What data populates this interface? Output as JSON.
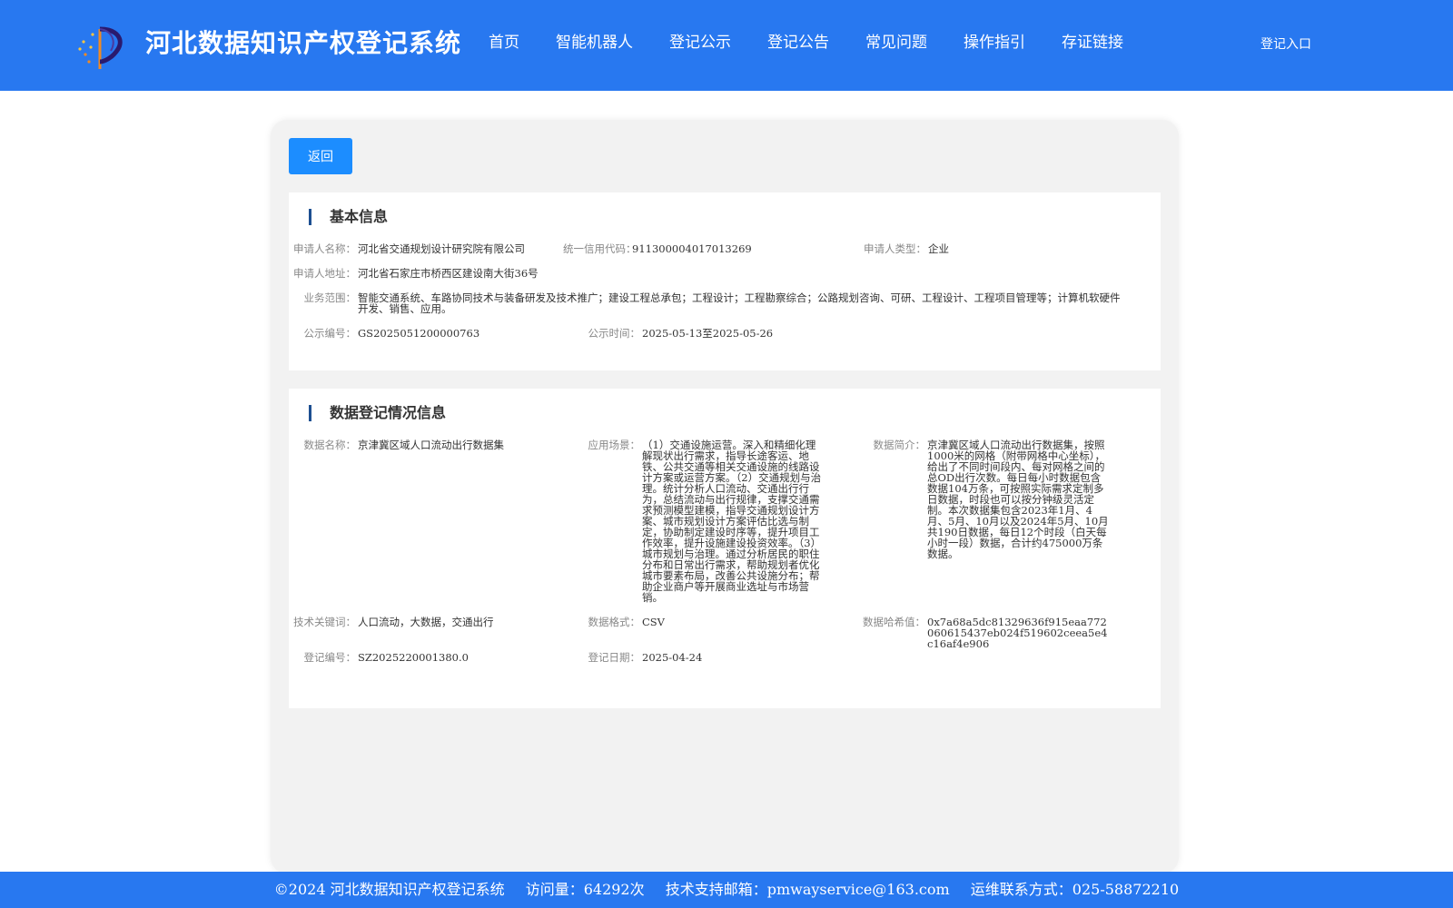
{
  "header": {
    "title": "河北数据知识产权登记系统",
    "nav": [
      "首页",
      "智能机器人",
      "登记公示",
      "登记公告",
      "常见问题",
      "操作指引",
      "存证链接"
    ],
    "login": "登记入口"
  },
  "back_label": "返回",
  "basic": {
    "title": "基本信息",
    "applicant_name_label": "申请人名称：",
    "applicant_name": "河北省交通规划设计研究院有限公司",
    "credit_code_label": "统一信用代码：",
    "credit_code": "91130000401701326​9",
    "applicant_type_label": "申请人类型：",
    "applicant_type": "企业",
    "address_label": "申请人地址：",
    "address": "河北省石家庄市桥西区建设南大街36号",
    "scope_label": "业务范围：",
    "scope": "智能交通系统、车路协同技术与装备研发及技术推广；建设工程总承包；工程设计；工程勘察综合；公路规划咨询、可研、工程设计、工程项目管理等；计算机软硬件开发、销售、应用。",
    "pub_no_label": "公示编号：",
    "pub_no": "GS2025051200000763",
    "pub_time_label": "公示时间：",
    "pub_time": "2025-05-13至2025-05-26"
  },
  "registration": {
    "title": "数据登记情况信息",
    "data_name_label": "数据名称：",
    "data_name": "京津冀区域人口流动出行数据集",
    "scenario_label": "应用场景：",
    "scenario": "（1）交通设施运营。深入和精细化理解现状出行需求，指导长途客运、地铁、公共交通等相关交通设施的线路设计方案或运营方案。（2）交通规划与治理。统计分析人口流动、交通出行行为，总结流动与出行规律，支撑交通需求预测模型建模，指导交通规划设计方案、城市规划设计方案评估比选与制定，协助制定建设时序等，提升项目工作效率，提升设施建设投资效率。（3）城市规划与治理。通过分析居民的职住分布和日常出行需求，帮助规划者优化城市要素布局，改善公共设施分布；帮助企业商户等开展商业选址与市场营销。",
    "intro_label": "数据简介：",
    "intro": "京津冀区域人口流动出行数据集，按照1000米的网格（附带网格中心坐标），给出了不同时间段内、每对网格之间的总OD出行次数。每日每小时数据包含数据104万条，可按照实际需求定制多日数据，时段也可以按分钟级灵活定制。本次数据集包含2023年1月、4月、5月、10月以及2024年5月、10月共190日数据，每日12个时段（白天每小时一段）数据，合计约475000万条数据。",
    "keywords_label": "技术关键词：",
    "keywords": "人口流动，大数据，交通出行",
    "format_label": "数据格式：",
    "format": "CSV",
    "hash_label": "数据哈希值：",
    "hash": "0x7a68a5dc81329636f915eaa772060615437eb024f519602ceea5e4c16af4e906",
    "reg_no_label": "登记编号：",
    "reg_no": "SZ2025220001380.0",
    "reg_date_label": "登记日期：",
    "reg_date": "2025-04-24"
  },
  "footer": {
    "copyright": "©2024 河北数据知识产权登记系统",
    "visits": "访问量：64292次",
    "email": "技术支持邮箱：pmwayservice@163.com",
    "phone": "运维联系方式：025-58872210"
  }
}
